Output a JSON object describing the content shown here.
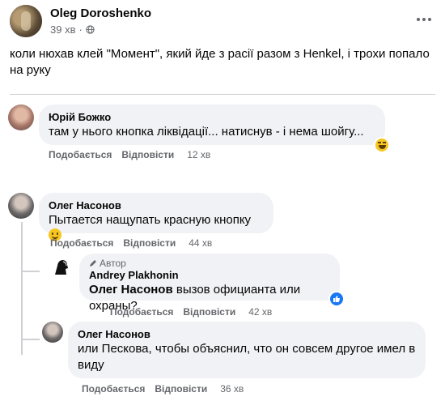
{
  "post": {
    "author": "Oleg Doroshenko",
    "time": "39 хв",
    "separator": "·",
    "text": "коли нюхав клей \"Момент\", який йде з расії разом з Henkel, і трохи попало на руку"
  },
  "comments": [
    {
      "author": "Юрій Божко",
      "text": "там у нього кнопка ліквідації... натиснув - і нема шойгу...",
      "like_label": "Подобається",
      "reply_label": "Відповісти",
      "time": "12 хв",
      "reaction": "laugh-icon"
    },
    {
      "author": "Олег Насонов",
      "text": "Пытается нащупать красную кнопку",
      "like_label": "Подобається",
      "reply_label": "Відповісти",
      "time": "44 хв"
    },
    {
      "badge": "Автор",
      "author": "Andrey Plakhonin",
      "mention": "Олег Насонов",
      "text": " вызов официанта или охраны?",
      "like_label": "Подобається",
      "reply_label": "Відповісти",
      "time": "42 хв",
      "reaction": "like-icon"
    },
    {
      "author": "Олег Насонов",
      "text": "или Пескова, чтобы объяснил, что он совсем другое имел в виду",
      "like_label": "Подобається",
      "reply_label": "Відповісти",
      "time": "36 хв"
    }
  ],
  "colors": {
    "bubble": "#f0f2f5",
    "secondary_text": "#65676b",
    "like_blue": "#1877f2"
  }
}
